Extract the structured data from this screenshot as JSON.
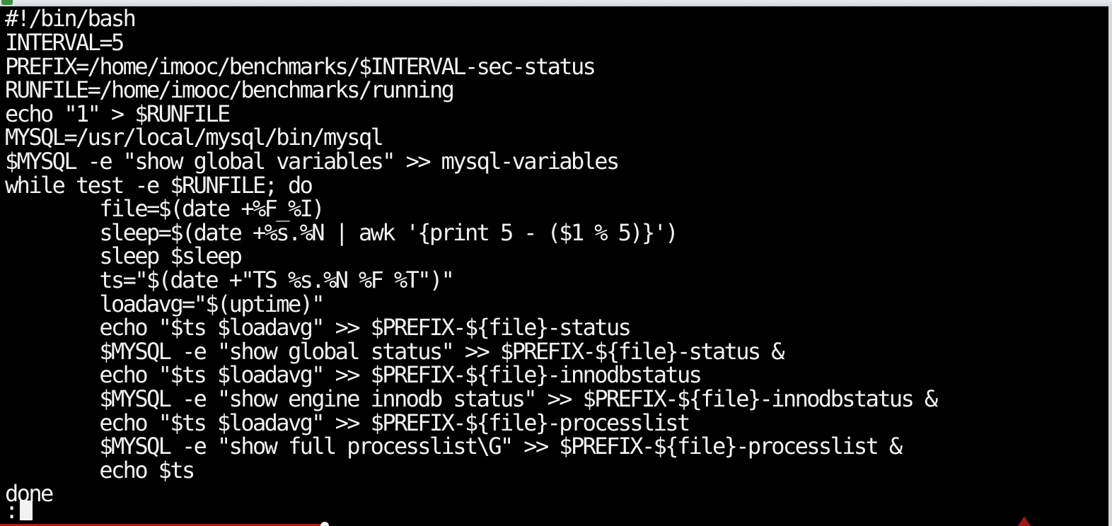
{
  "terminal": {
    "lines": [
      "#!/bin/bash",
      "INTERVAL=5",
      "PREFIX=/home/imooc/benchmarks/$INTERVAL-sec-status",
      "RUNFILE=/home/imooc/benchmarks/running",
      "echo \"1\" > $RUNFILE",
      "MYSQL=/usr/local/mysql/bin/mysql",
      "$MYSQL -e \"show global variables\" >> mysql-variables",
      "while test -e $RUNFILE; do",
      "        file=$(date +%F_%I)",
      "        sleep=$(date +%s.%N | awk '{print 5 - ($1 % 5)}')",
      "        sleep $sleep",
      "        ts=\"$(date +\"TS %s.%N %F %T\")\"",
      "        loadavg=\"$(uptime)\"",
      "        echo \"$ts $loadavg\" >> $PREFIX-${file}-status",
      "        $MYSQL -e \"show global status\" >> $PREFIX-${file}-status &",
      "        echo \"$ts $loadavg\" >> $PREFIX-${file}-innodbstatus",
      "        $MYSQL -e \"show engine innodb status\" >> $PREFIX-${file}-innodbstatus &",
      "        echo \"$ts $loadavg\" >> $PREFIX-${file}-processlist",
      "        $MYSQL -e \"show full processlist\\G\" >> $PREFIX-${file}-processlist &",
      "        echo $ts",
      "done"
    ],
    "prompt": ":"
  },
  "colors": {
    "background": "#000000",
    "text": "#f2f2f2"
  }
}
